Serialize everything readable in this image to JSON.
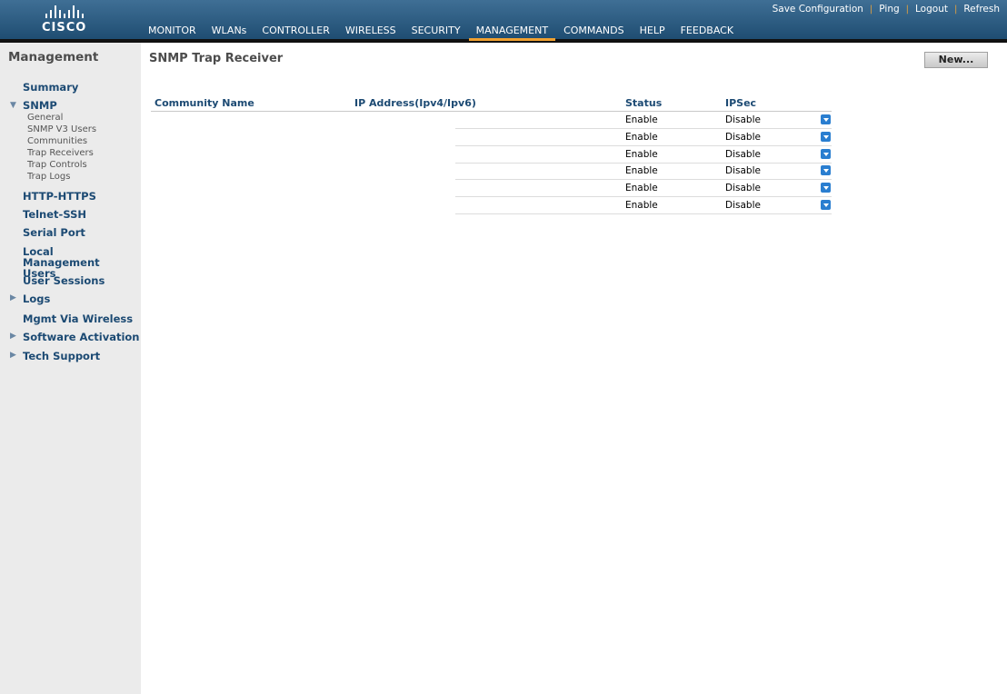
{
  "brand": {
    "name": "CISCO"
  },
  "top_links": [
    "Save Configuration",
    "Ping",
    "Logout",
    "Refresh"
  ],
  "nav_tabs": [
    "MONITOR",
    "WLANs",
    "CONTROLLER",
    "WIRELESS",
    "SECURITY",
    "MANAGEMENT",
    "COMMANDS",
    "HELP",
    "FEEDBACK"
  ],
  "active_tab": "MANAGEMENT",
  "accent_color": "#f0a030",
  "sidebar": {
    "title": "Management",
    "summary": "Summary",
    "snmp": "SNMP",
    "snmp_items": [
      "General",
      "SNMP V3 Users",
      "Communities",
      "Trap Receivers",
      "Trap Controls",
      "Trap Logs"
    ],
    "http": "HTTP-HTTPS",
    "telnet": "Telnet-SSH",
    "serial": "Serial Port",
    "local_mgmt": "Local Management Users",
    "user_sessions": "User Sessions",
    "logs": "Logs",
    "mgmt_wireless": "Mgmt Via Wireless",
    "software": "Software Activation",
    "tech": "Tech Support"
  },
  "page": {
    "title": "SNMP Trap Receiver",
    "new_button": "New..."
  },
  "table": {
    "headers": {
      "community": "Community Name",
      "ip": "IP Address(Ipv4/Ipv6)",
      "status": "Status",
      "ipsec": "IPSec"
    },
    "rows": [
      {
        "status": "Enable",
        "ipsec": "Disable"
      },
      {
        "status": "Enable",
        "ipsec": "Disable"
      },
      {
        "status": "Enable",
        "ipsec": "Disable"
      },
      {
        "status": "Enable",
        "ipsec": "Disable"
      },
      {
        "status": "Enable",
        "ipsec": "Disable"
      },
      {
        "status": "Enable",
        "ipsec": "Disable"
      }
    ]
  }
}
